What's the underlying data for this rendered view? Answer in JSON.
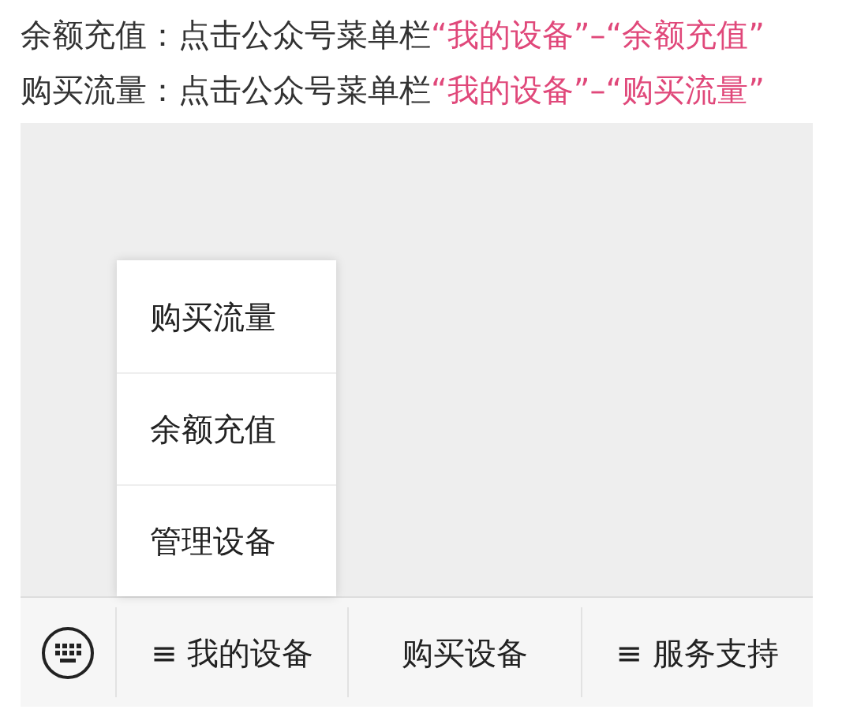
{
  "instructions": [
    {
      "text": "余额充值：点击公众号菜单栏",
      "highlight": "“我的设备”–“余额充值”"
    },
    {
      "text": "购买流量：点击公众号菜单栏",
      "highlight": "“我的设备”–“购买流量”"
    }
  ],
  "submenu": {
    "items": [
      "购买流量",
      "余额充值",
      "管理设备"
    ]
  },
  "menu_bar": {
    "items": [
      "≡ 我的设备",
      "购买设备",
      "≡ 服务支持"
    ]
  }
}
